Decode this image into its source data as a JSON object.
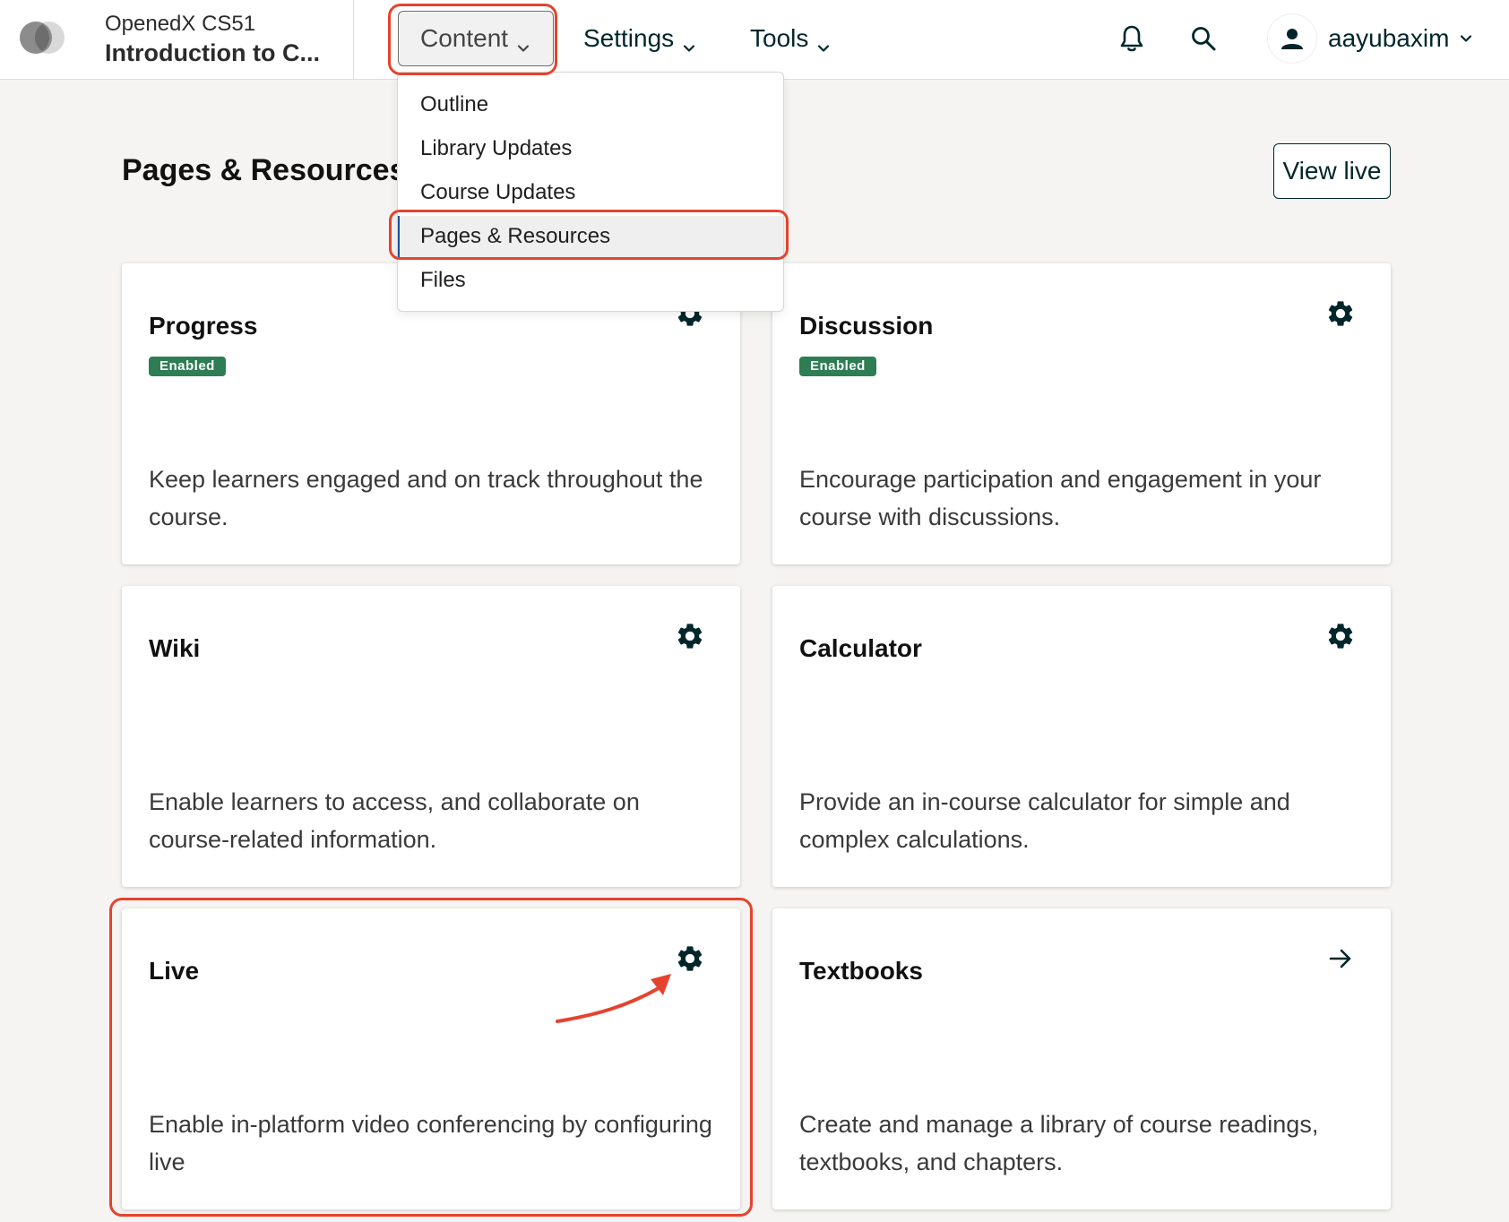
{
  "header": {
    "course_org": "OpenedX CS51",
    "course_title": "Introduction to C...",
    "nav": {
      "content_label": "Content",
      "settings_label": "Settings",
      "tools_label": "Tools"
    },
    "username": "aayubaxim"
  },
  "content_menu": {
    "items": [
      {
        "label": "Outline"
      },
      {
        "label": "Library Updates"
      },
      {
        "label": "Course Updates"
      },
      {
        "label": "Pages & Resources",
        "active": true
      },
      {
        "label": "Files"
      }
    ]
  },
  "page": {
    "title": "Pages & Resources",
    "view_live_label": "View live"
  },
  "cards": [
    {
      "title": "Progress",
      "badge": "Enabled",
      "description": "Keep learners engaged and on track throughout the course.",
      "action": "gear-icon"
    },
    {
      "title": "Discussion",
      "badge": "Enabled",
      "description": "Encourage participation and engagement in your course with discussions.",
      "action": "gear-icon"
    },
    {
      "title": "Wiki",
      "description": "Enable learners to access, and collaborate on course-related information.",
      "action": "gear-icon"
    },
    {
      "title": "Calculator",
      "description": "Provide an in-course calculator for simple and complex calculations.",
      "action": "gear-icon"
    },
    {
      "title": "Live",
      "description": "Enable in-platform video conferencing by configuring live",
      "action": "gear-icon"
    },
    {
      "title": "Textbooks",
      "description": "Create and manage a library of course readings, textbooks, and chapters.",
      "action": "arrow-right-icon"
    }
  ],
  "colors": {
    "primary_text": "#00262b",
    "badge_success": "#2e7d55",
    "annotation_red": "#e5432d",
    "page_background": "#f5f4f2"
  }
}
